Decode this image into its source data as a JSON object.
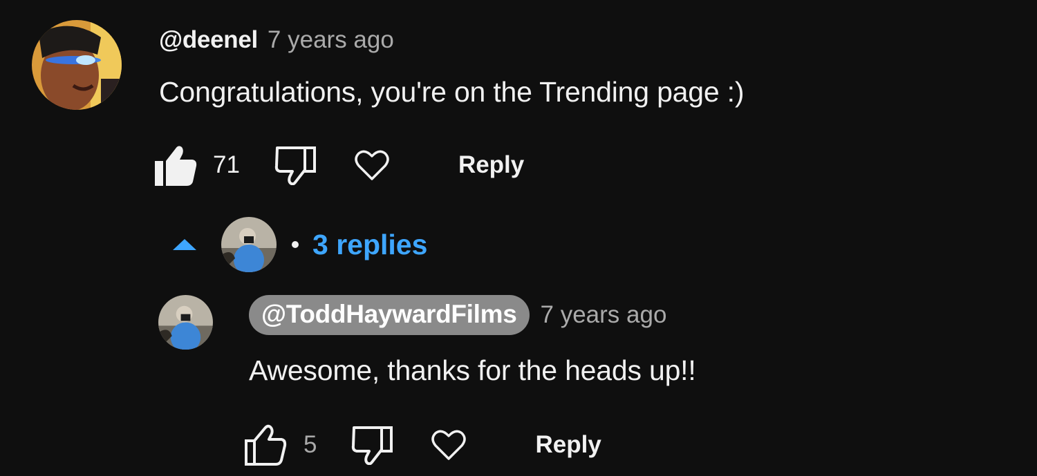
{
  "comment": {
    "author": "@deenel",
    "time": "7 years ago",
    "text": "Congratulations, you're on the Trending page :)",
    "likes": "71",
    "reply_label": "Reply",
    "liked": true
  },
  "replies_toggle": {
    "count_label": "3 replies",
    "accent_color": "#3ea6ff"
  },
  "reply": {
    "author": "@ToddHaywardFilms",
    "time": "7 years ago",
    "text": "Awesome, thanks for the heads up!!",
    "likes": "5",
    "reply_label": "Reply",
    "liked": false
  },
  "icons": {
    "like_filled": "thumbs-up-filled-icon",
    "like_outline": "thumbs-up-outline-icon",
    "dislike": "thumbs-down-icon",
    "heart": "heart-icon",
    "collapse": "caret-up-icon"
  }
}
